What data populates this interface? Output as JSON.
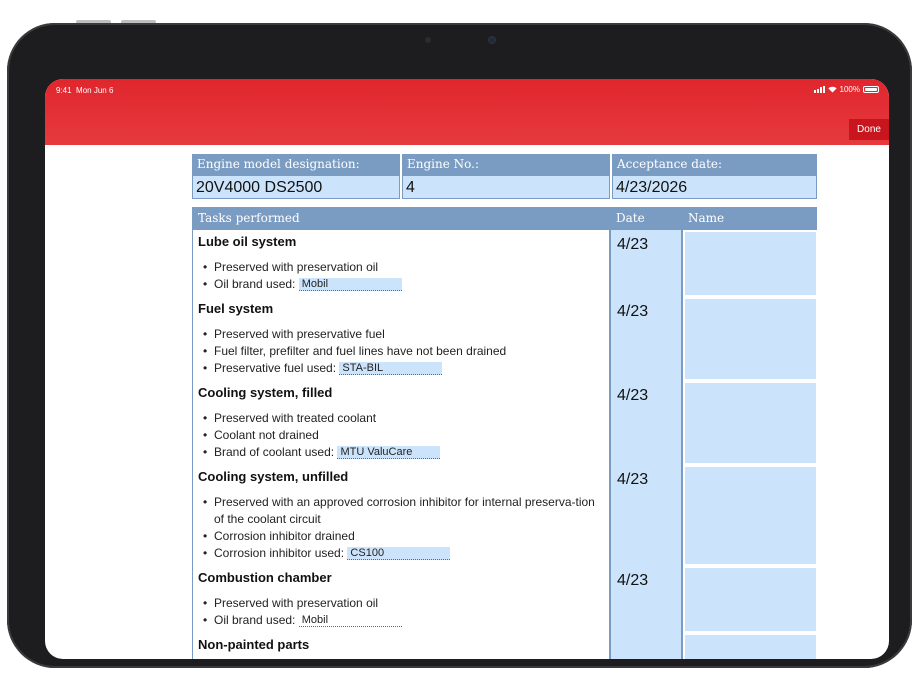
{
  "status_bar": {
    "time": "9:41",
    "day": "Mon Jun 6",
    "battery": "100%"
  },
  "toolbar": {
    "done_label": "Done"
  },
  "header_fields": {
    "model_label": "Engine model designation:",
    "model_value": "20V4000 DS2500",
    "engine_no_label": "Engine No.:",
    "engine_no_value": "4",
    "acceptance_label": "Acceptance date:",
    "acceptance_value": "4/23/2026"
  },
  "task_table": {
    "col_tasks": "Tasks performed",
    "col_date": "Date",
    "col_name": "Name",
    "rows": [
      {
        "title": "Lube oil system",
        "date": "4/23",
        "items": [
          "Preserved with preservation oil",
          "Oil brand used:"
        ],
        "fill_value": "Mobil"
      },
      {
        "title": "Fuel system",
        "date": "4/23",
        "items": [
          "Preserved with preservative fuel",
          "Fuel filter, prefilter and fuel lines have not been drained",
          "Preservative fuel used:"
        ],
        "fill_value": "STA-BIL"
      },
      {
        "title": "Cooling system, filled",
        "date": "4/23",
        "items": [
          "Preserved with treated coolant",
          "Coolant not drained",
          "Brand of coolant used:"
        ],
        "fill_value": "MTU ValuCare"
      },
      {
        "title": "Cooling system, unfilled",
        "date": "4/23",
        "items": [
          "Preserved with an approved corrosion inhibitor for internal preserva-tion of the coolant circuit",
          "Corrosion inhibitor drained",
          "Corrosion inhibitor used:"
        ],
        "fill_value": "CS100"
      },
      {
        "title": "Combustion chamber",
        "date": "4/23",
        "items": [
          "Preserved with preservation oil",
          "Oil brand used:"
        ],
        "fill_value": "Mobil"
      },
      {
        "title": "Non-painted parts",
        "date": "",
        "items": [],
        "fill_value": ""
      }
    ]
  }
}
